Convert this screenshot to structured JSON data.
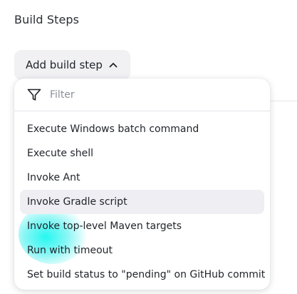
{
  "section": {
    "title": "Build Steps"
  },
  "add_build_step": {
    "label": "Add build step",
    "chevron_icon": "chevron-up-icon"
  },
  "filter": {
    "placeholder": "Filter",
    "value": "",
    "icon": "filter-icon"
  },
  "menu": {
    "items": [
      {
        "label": "Execute Windows batch command"
      },
      {
        "label": "Execute shell"
      },
      {
        "label": "Invoke Ant"
      },
      {
        "label": "Invoke Gradle script"
      },
      {
        "label": "Invoke top-level Maven targets"
      },
      {
        "label": "Run with timeout"
      },
      {
        "label": "Set build status to \"pending\" on GitHub commit"
      }
    ],
    "hovered_index": 3
  },
  "colors": {
    "button_bg": "#f1f1f4",
    "hover_bg": "#eeeef3",
    "text": "#1f2329",
    "placeholder": "#8a8f98",
    "highlight_glow": "#00f6ee"
  }
}
